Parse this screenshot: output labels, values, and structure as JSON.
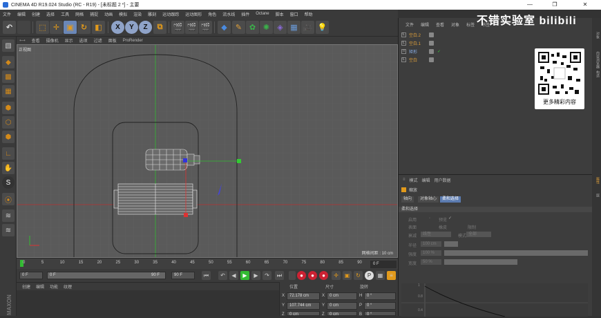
{
  "window": {
    "title": "CINEMA 4D R19.024 Studio (RC - R19) - [未标题 2 *] - 主要",
    "controls": [
      "—",
      "❐",
      "✕"
    ]
  },
  "menubar": [
    "文件",
    "编辑",
    "创建",
    "选择",
    "工具",
    "网格",
    "捕捉",
    "动画",
    "模拟",
    "渲染",
    "雕刻",
    "运动跟踪",
    "运动图形",
    "角色",
    "流水线",
    "插件",
    "Octane",
    "脚本",
    "窗口",
    "帮助"
  ],
  "toolbar": {
    "axis_x": "X",
    "axis_y": "Y",
    "axis_z": "Z"
  },
  "viewport": {
    "menu": [
      "查看",
      "摄像机",
      "显示",
      "选项",
      "过滤",
      "面板",
      "ProRender"
    ],
    "label": "正视图",
    "grid_info": "网格间距 : 10 cm"
  },
  "timeline": {
    "ticks": [
      "0",
      "5",
      "10",
      "15",
      "20",
      "25",
      "30",
      "35",
      "40",
      "45",
      "50",
      "55",
      "60",
      "65",
      "70",
      "75",
      "80",
      "85",
      "90"
    ],
    "current": "0 F"
  },
  "playbar": {
    "start": "0 F",
    "range_start": "0 F",
    "range_end": "90 F",
    "end": "90 F"
  },
  "material": {
    "menu": [
      "创建",
      "编辑",
      "功能",
      "纹理"
    ]
  },
  "coords": {
    "headers": [
      "位置",
      "尺寸",
      "旋转"
    ],
    "rows": [
      {
        "axis": "X",
        "pos": "72.178 cm",
        "size_axis": "X",
        "size": "0 cm",
        "rot_axis": "H",
        "rot": "0 °"
      },
      {
        "axis": "Y",
        "pos": "107.744 cm",
        "size_axis": "Y",
        "size": "0 cm",
        "rot_axis": "P",
        "rot": "0 °"
      },
      {
        "axis": "Z",
        "pos": "0 cm",
        "size_axis": "Z",
        "size": "0 cm",
        "rot_axis": "B",
        "rot": "0 °"
      }
    ]
  },
  "objects": {
    "menu": [
      "文件",
      "编辑",
      "查看",
      "对象",
      "标签",
      "书签"
    ],
    "items": [
      {
        "name": "空白.2"
      },
      {
        "name": "空白.1"
      },
      {
        "name": "矩形"
      },
      {
        "name": "空白"
      }
    ]
  },
  "attributes": {
    "menu": [
      "模式",
      "编辑",
      "用户数据"
    ],
    "object": "缩放",
    "tabs": [
      "轴向",
      "对象轴心",
      "柔和选择"
    ],
    "section": "柔和选择",
    "fields": {
      "enable": "启用",
      "preview": "预览",
      "surface": "表面",
      "rubber": "橡皮",
      "restrict": "限制",
      "falloff": "衰减",
      "falloff_val": "线性",
      "mode": "模式",
      "mode_val": "全部",
      "radius": "半径",
      "radius_val": "100 cm",
      "strength": "强度",
      "strength_val": "100 %",
      "width": "宽度",
      "width_val": "50 %"
    },
    "graph_labels": [
      "1",
      "0.8",
      "0.4"
    ]
  },
  "side_tabs": [
    "对象",
    "内容浏览器",
    "构造",
    "层"
  ],
  "side_tabs2": [
    "属性"
  ],
  "overlay": {
    "logo": "不错实验室 bilibili",
    "caption": "更多精彩内容"
  }
}
